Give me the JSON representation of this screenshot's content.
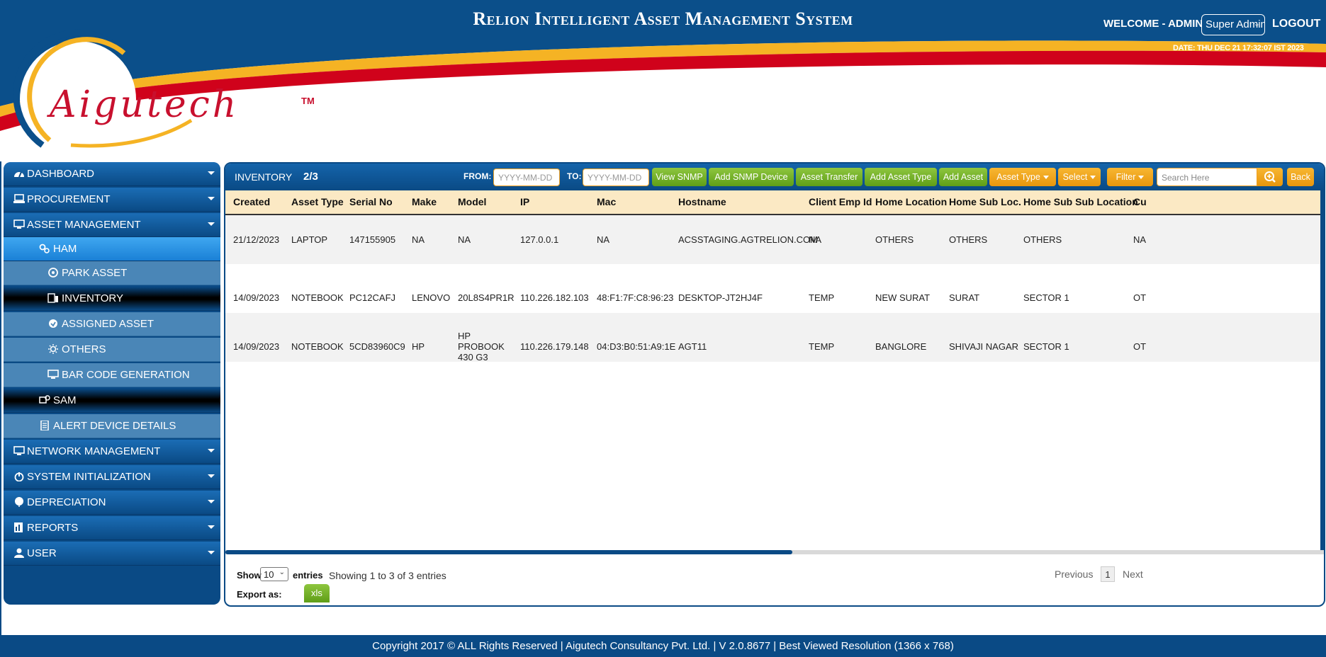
{
  "header": {
    "title": "Relion Intelligent Asset Management System",
    "welcome": "WELCOME - ADMIN",
    "role_selected": "Super Admin",
    "logout": "LOGOUT",
    "date": "DATE: THU DEC 21 17:32:07 IST 2023",
    "logo_text": "Aigutech",
    "logo_tm": "TM"
  },
  "sidebar": {
    "dashboard": "DASHBOARD",
    "procurement": "PROCUREMENT",
    "asset_management": "ASSET MANAGEMENT",
    "ham": "HAM",
    "park_asset": "PARK ASSET",
    "inventory": "INVENTORY",
    "assigned_asset": "ASSIGNED ASSET",
    "others": "OTHERS",
    "bar_code": "BAR CODE GENERATION",
    "sam": "SAM",
    "alert_device": "ALERT DEVICE DETAILS",
    "network_management": "NETWORK MANAGEMENT",
    "system_initialization": "SYSTEM INITIALIZATION",
    "depreciation": "DEPRECIATION",
    "reports": "REPORTS",
    "user": "USER"
  },
  "toolbar": {
    "title": "INVENTORY",
    "count": "2/3",
    "from_label": "FROM:",
    "to_label": "TO:",
    "date_placeholder": "YYYY-MM-DD",
    "view_snmp": "View SNMP",
    "add_snmp": "Add SNMP Device",
    "asset_transfer": "Asset Transfer",
    "add_asset_type": "Add Asset Type",
    "add_asset": "Add Asset",
    "asset_type": "Asset Type",
    "select": "Select",
    "filter": "Filter",
    "search_placeholder": "Search Here",
    "back": "Back"
  },
  "table": {
    "columns": [
      "Created",
      "Asset Type",
      "Serial No",
      "Make",
      "Model",
      "IP",
      "Mac",
      "Hostname",
      "Client Emp Id",
      "Home Location",
      "Home Sub Loc.",
      "Home Sub Sub Location",
      "Cu"
    ],
    "rows": [
      [
        "21/12/2023",
        "LAPTOP",
        "147155905",
        "NA",
        "NA",
        "127.0.0.1",
        "NA",
        "ACSSTAGING.AGTRELION.COM",
        "NA",
        "OTHERS",
        "OTHERS",
        "OTHERS",
        "NA"
      ],
      [
        "14/09/2023",
        "NOTEBOOK",
        "PC12CAFJ",
        "LENOVO",
        "20L8S4PR1R",
        "110.226.182.103",
        "48:F1:7F:C8:96:23",
        "DESKTOP-JT2HJ4F",
        "TEMP",
        "NEW SURAT",
        "SURAT",
        "SECTOR 1",
        "OT"
      ],
      [
        "14/09/2023",
        "NOTEBOOK",
        "5CD83960C9",
        "HP",
        "HP PROBOOK 430 G3",
        "110.226.179.148",
        "04:D3:B0:51:A9:1E",
        "AGT11",
        "TEMP",
        "BANGLORE",
        "SHIVAJI NAGAR",
        "SECTOR 1",
        "OT"
      ]
    ],
    "model_lines": [
      "HP",
      "PROBOOK",
      "430 G3"
    ]
  },
  "table_footer": {
    "show": "Show",
    "entries_value": "10",
    "entries": "entries",
    "showing": "Showing 1 to 3 of 3 entries",
    "previous": "Previous",
    "page": "1",
    "next": "Next",
    "export_as": "Export as:",
    "xls": "xls"
  },
  "footer": {
    "copyright": "Copyright 2017 © ALL Rights Reserved | Aigutech Consultancy Pvt. Ltd. | V 2.0.8677 | Best Viewed Resolution (1366 x 768)"
  },
  "colors": {
    "brand_blue": "#0a4a85",
    "accent_yellow": "#f5b324",
    "accent_red": "#d0021b",
    "button_green": "#7bb32e",
    "button_orange": "#f0a020",
    "table_header": "#fbe9c4"
  }
}
